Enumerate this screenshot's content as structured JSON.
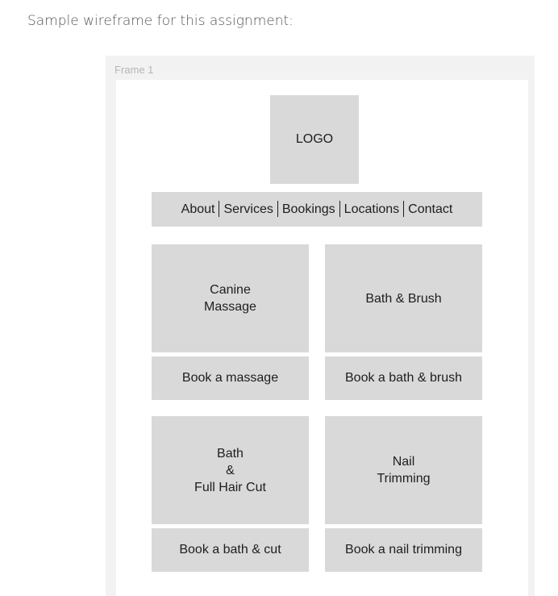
{
  "intro_text": "Sample wireframe for this assignment:",
  "frame": {
    "label": "Frame 1",
    "logo_text": "LOGO",
    "nav": [
      "About",
      "Services",
      "Bookings",
      "Locations",
      "Contact"
    ],
    "services": [
      {
        "title": "Canine\nMassage",
        "button": "Book a massage"
      },
      {
        "title": "Bath & Brush",
        "button": "Book a bath & brush"
      },
      {
        "title": "Bath\n&\nFull Hair Cut",
        "button": "Book a bath & cut"
      },
      {
        "title": "Nail\nTrimming",
        "button": "Book a nail trimming"
      }
    ]
  }
}
